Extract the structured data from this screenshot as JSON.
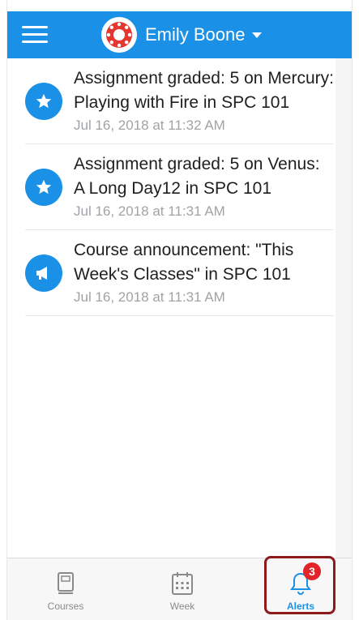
{
  "header": {
    "user_name": "Emily Boone",
    "accent_color": "#1a90e6"
  },
  "notifications": [
    {
      "icon": "star-icon",
      "title": "Assignment graded: 5 on Mercury: Playing with Fire in SPC 101",
      "date": "Jul 16, 2018 at 11:32 AM"
    },
    {
      "icon": "star-icon",
      "title": "Assignment graded: 5 on Venus: A Long Day12 in SPC 101",
      "date": "Jul 16, 2018 at 11:31 AM"
    },
    {
      "icon": "megaphone-icon",
      "title": "Course announcement: \"This Week's Classes\" in SPC 101",
      "date": "Jul 16, 2018 at 11:31 AM"
    }
  ],
  "tabbar": {
    "courses_label": "Courses",
    "week_label": "Week",
    "alerts_label": "Alerts",
    "alerts_badge": "3",
    "badge_color": "#e0242a",
    "highlight_color": "#8e1b1b"
  }
}
